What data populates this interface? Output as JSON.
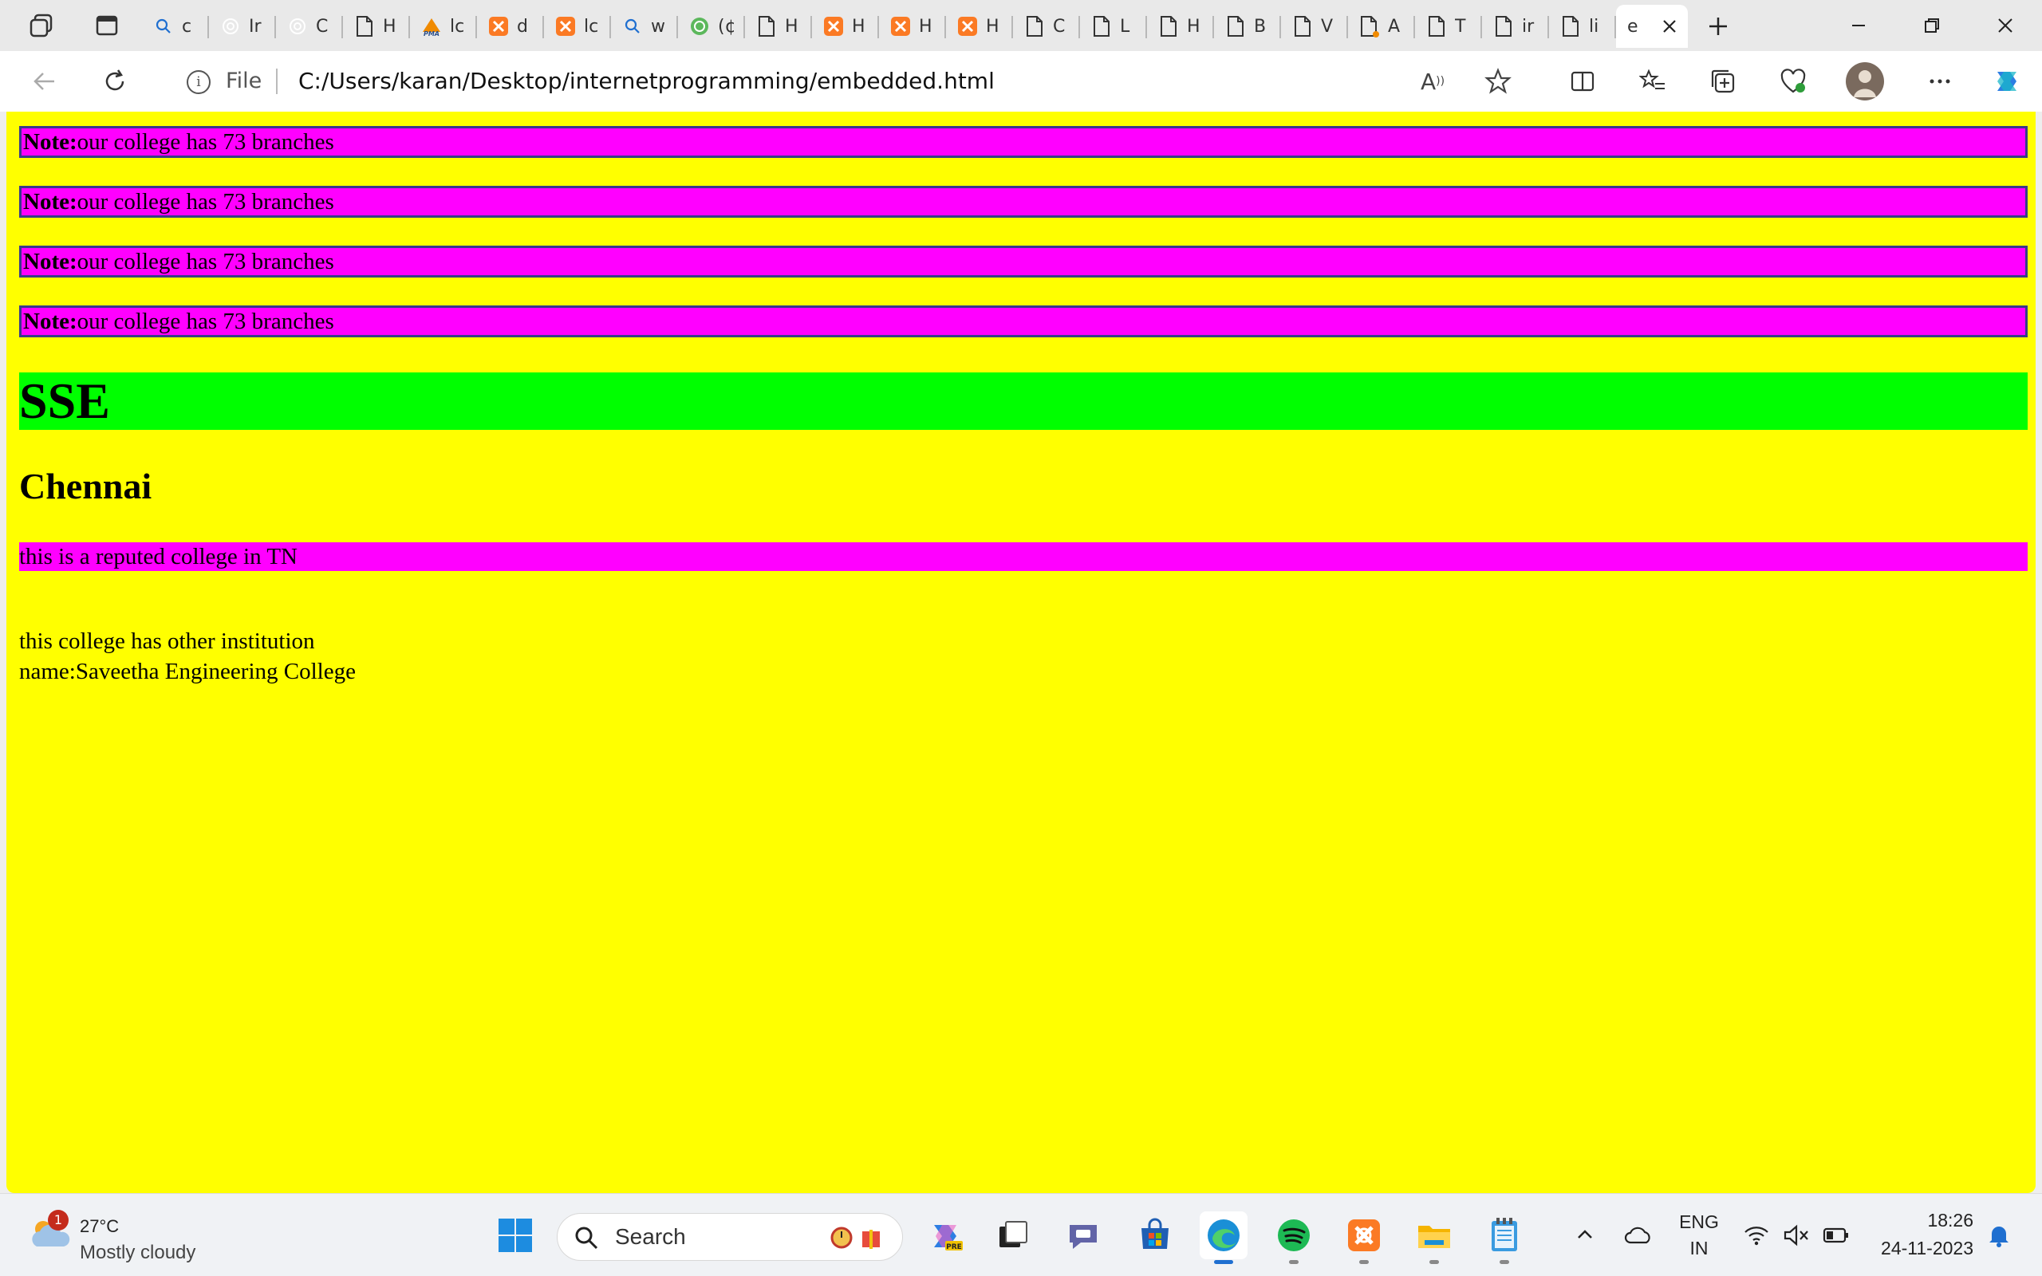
{
  "browser": {
    "tabs": [
      {
        "favicon": "search-icon",
        "text": "c"
      },
      {
        "favicon": "chatgpt-icon",
        "text": "Ir"
      },
      {
        "favicon": "chatgpt-icon",
        "text": "C"
      },
      {
        "favicon": "page-icon",
        "text": "H"
      },
      {
        "favicon": "phpmyadmin-icon",
        "text": "lc"
      },
      {
        "favicon": "xampp-icon",
        "text": "d"
      },
      {
        "favicon": "xampp-icon",
        "text": "lc"
      },
      {
        "favicon": "search-icon",
        "text": "w"
      },
      {
        "favicon": "green-circle-icon",
        "text": "(¢"
      },
      {
        "favicon": "page-icon",
        "text": "H"
      },
      {
        "favicon": "xampp-icon",
        "text": "H"
      },
      {
        "favicon": "xampp-icon",
        "text": "H"
      },
      {
        "favicon": "xampp-icon",
        "text": "H"
      },
      {
        "favicon": "page-icon",
        "text": "C"
      },
      {
        "favicon": "page-icon",
        "text": "L"
      },
      {
        "favicon": "page-icon",
        "text": "H"
      },
      {
        "favicon": "page-icon",
        "text": "B"
      },
      {
        "favicon": "page-icon",
        "text": "V"
      },
      {
        "favicon": "page-edit-icon",
        "text": "A"
      },
      {
        "favicon": "page-icon",
        "text": "T"
      },
      {
        "favicon": "page-icon",
        "text": "ir"
      },
      {
        "favicon": "page-icon",
        "text": "li"
      }
    ],
    "active_tab": {
      "text": "e"
    },
    "address": {
      "scheme_label": "File",
      "url": "C:/Users/karan/Desktop/internetprogramming/embedded.html"
    }
  },
  "page": {
    "notes": [
      {
        "label": "Note:",
        "text": "our college has 73 branches"
      },
      {
        "label": "Note:",
        "text": "our college has 73 branches"
      },
      {
        "label": "Note:",
        "text": "our college has 73 branches"
      },
      {
        "label": "Note:",
        "text": "our college has 73 branches"
      }
    ],
    "heading1": "SSE",
    "heading2": "Chennai",
    "highlight_paragraph": "this is a reputed college in TN",
    "other_line1": "this college has other institution",
    "other_line2": "name:Saveetha Engineering College"
  },
  "taskbar": {
    "weather": {
      "temp": "27°C",
      "condition": "Mostly cloudy",
      "badge": "1"
    },
    "search_label": "Search",
    "language_line1": "ENG",
    "language_line2": "IN",
    "time": "18:26",
    "date": "24-11-2023"
  },
  "colors": {
    "page_background": "#ffff00",
    "note_background": "#ff00ff",
    "heading_background": "#00ff00"
  }
}
